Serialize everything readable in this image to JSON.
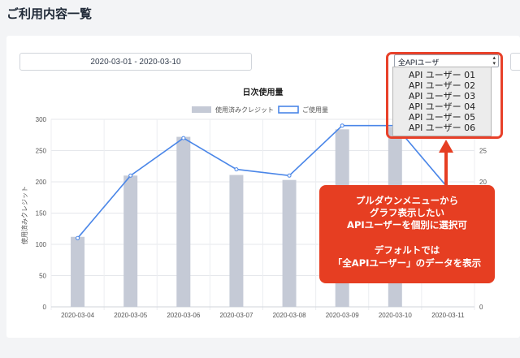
{
  "page": {
    "title": "ご利用内容一覧"
  },
  "filters": {
    "date_range": "2020-03-01 - 2020-03-10",
    "user_select": {
      "selected": "全APIユーザ"
    },
    "dropdown_options": [
      "API ユーザー 01",
      "API ユーザー 02",
      "API ユーザー 03",
      "API ユーザー 04",
      "API ユーザー 05",
      "API ユーザー 06"
    ]
  },
  "callout": {
    "line1": "プルダウンメニューから",
    "line2": "グラフ表示したい",
    "line3": "APIユーザーを個別に選択可",
    "line4": "デフォルトでは",
    "line5": "「全APIユーザー」のデータを表示"
  },
  "colors": {
    "accent": "#e63e22",
    "bar": "#c5cad6",
    "line": "#4a86e8"
  },
  "chart_data": {
    "type": "bar",
    "title": "日次使用量",
    "categories": [
      "2020-03-04",
      "2020-03-05",
      "2020-03-06",
      "2020-03-07",
      "2020-03-08",
      "2020-03-09",
      "2020-03-10",
      "2020-03-11"
    ],
    "series": [
      {
        "name": "使用済みクレジット",
        "type": "bar",
        "axis": "left",
        "values": [
          112,
          210,
          272,
          211,
          203,
          284,
          288,
          null
        ]
      },
      {
        "name": "ご使用量",
        "type": "line",
        "axis": "right",
        "values": [
          11,
          21,
          27,
          22,
          21,
          29,
          29,
          19
        ]
      }
    ],
    "ylabel": "使用済みクレジット",
    "ylim": [
      0,
      300
    ],
    "yticks": [
      0,
      50,
      100,
      150,
      200,
      250,
      300
    ],
    "y2lim": [
      0,
      30
    ],
    "y2ticks": [
      0,
      10,
      20,
      25
    ],
    "grid": true,
    "legend_position": "top-center"
  }
}
